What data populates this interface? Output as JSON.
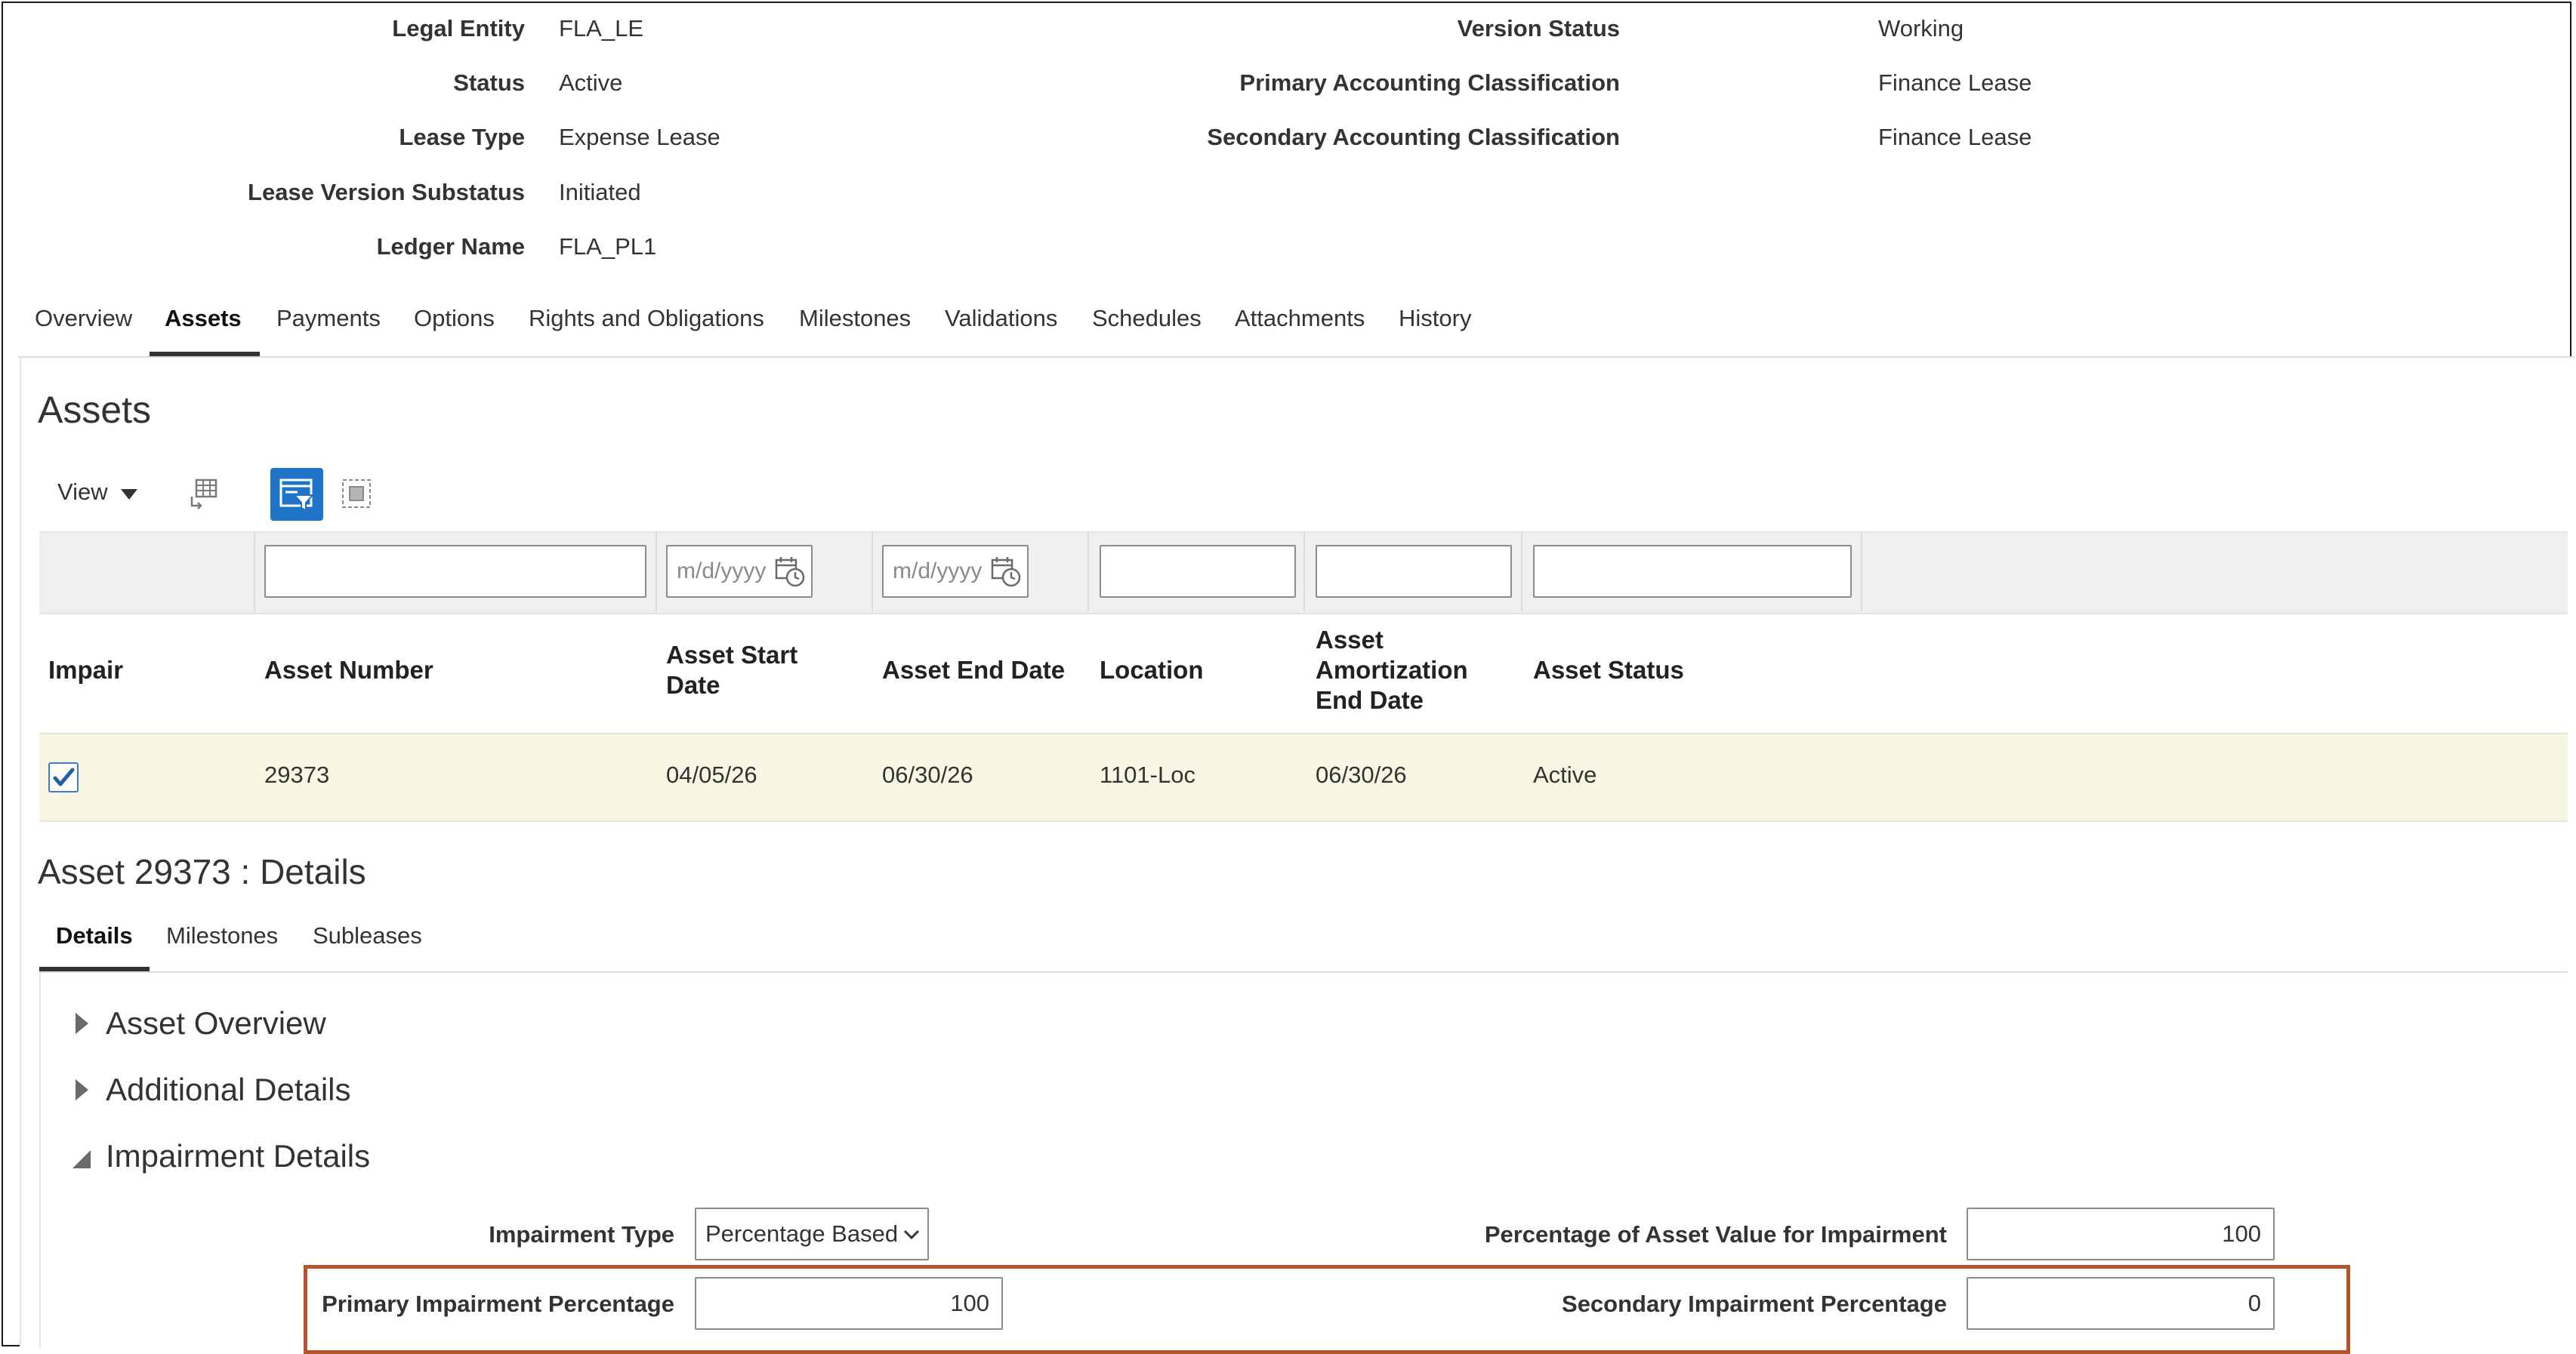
{
  "header": {
    "left": [
      {
        "label": "Legal Entity",
        "value": "FLA_LE"
      },
      {
        "label": "Status",
        "value": "Active"
      },
      {
        "label": "Lease Type",
        "value": "Expense Lease"
      },
      {
        "label": "Lease Version Substatus",
        "value": "Initiated"
      },
      {
        "label": "Ledger Name",
        "value": "FLA_PL1"
      }
    ],
    "right": [
      {
        "label": "Version Status",
        "value": "Working"
      },
      {
        "label": "Primary Accounting Classification",
        "value": "Finance Lease"
      },
      {
        "label": "Secondary Accounting Classification",
        "value": "Finance Lease"
      }
    ]
  },
  "tabs": [
    {
      "label": "Overview"
    },
    {
      "label": "Assets",
      "active": true
    },
    {
      "label": "Payments"
    },
    {
      "label": "Options"
    },
    {
      "label": "Rights and Obligations"
    },
    {
      "label": "Milestones"
    },
    {
      "label": "Validations"
    },
    {
      "label": "Schedules"
    },
    {
      "label": "Attachments"
    },
    {
      "label": "History"
    }
  ],
  "assets": {
    "title": "Assets",
    "toolbar": {
      "view_label": "View",
      "icons": [
        "freeze-columns-icon",
        "query-by-example-icon",
        "detach-icon"
      ]
    },
    "filters": {
      "asset_number": "",
      "asset_start_date_placeholder": "m/d/yyyy",
      "asset_end_date_placeholder": "m/d/yyyy",
      "location": "",
      "amortization_end_date": "",
      "asset_status": ""
    },
    "columns": {
      "impair": "Impair",
      "asset_number": "Asset Number",
      "asset_start_date": [
        "Asset Start",
        "Date"
      ],
      "asset_end_date": "Asset End Date",
      "location": "Location",
      "amortization_end_date": [
        "Asset",
        "Amortization",
        "End Date"
      ],
      "asset_status": "Asset Status"
    },
    "rows": [
      {
        "impair": true,
        "asset_number": "29373",
        "asset_start_date": "04/05/26",
        "asset_end_date": "06/30/26",
        "location": "1101-Loc",
        "amortization_end_date": "06/30/26",
        "asset_status": "Active"
      }
    ]
  },
  "details": {
    "title": "Asset 29373 : Details",
    "subtabs": [
      {
        "label": "Details",
        "active": true
      },
      {
        "label": "Milestones"
      },
      {
        "label": "Subleases"
      }
    ],
    "sections": [
      {
        "label": "Asset Overview",
        "expanded": false
      },
      {
        "label": "Additional Details",
        "expanded": false
      },
      {
        "label": "Impairment Details",
        "expanded": true
      }
    ],
    "impairment": {
      "impairment_type_label": "Impairment Type",
      "impairment_type_value": "Percentage Based",
      "percentage_asset_value_label": "Percentage of Asset Value for Impairment",
      "percentage_asset_value": "100",
      "primary_pct_label": "Primary Impairment Percentage",
      "primary_pct_value": "100",
      "secondary_pct_label": "Secondary Impairment Percentage",
      "secondary_pct_value": "0"
    }
  },
  "colors": {
    "highlight_border": "#b5562a",
    "selected_row": "#f7f7e4",
    "checkbox_blue": "#3f7cc2",
    "toolbar_active": "#1f74c8"
  }
}
